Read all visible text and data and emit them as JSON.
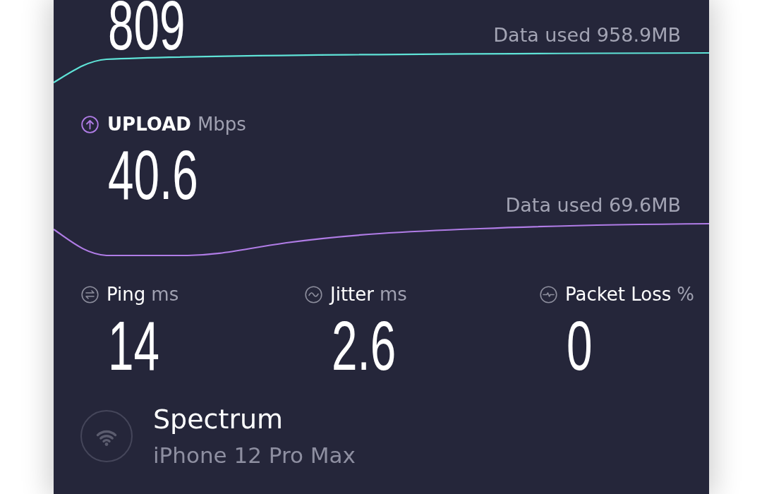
{
  "download": {
    "value": "809",
    "data_used": "Data used 958.9MB"
  },
  "upload": {
    "label": "UPLOAD",
    "unit": "Mbps",
    "value": "40.6",
    "data_used": "Data used 69.6MB"
  },
  "metrics": [
    {
      "kind": "ping",
      "label": "Ping",
      "unit": "ms",
      "value": "14"
    },
    {
      "kind": "jitter",
      "label": "Jitter",
      "unit": "ms",
      "value": "2.6"
    },
    {
      "kind": "packet_loss",
      "label": "Packet Loss",
      "unit": "%",
      "value": "0"
    }
  ],
  "connection": {
    "provider": "Spectrum",
    "device": "iPhone 12 Pro Max"
  }
}
